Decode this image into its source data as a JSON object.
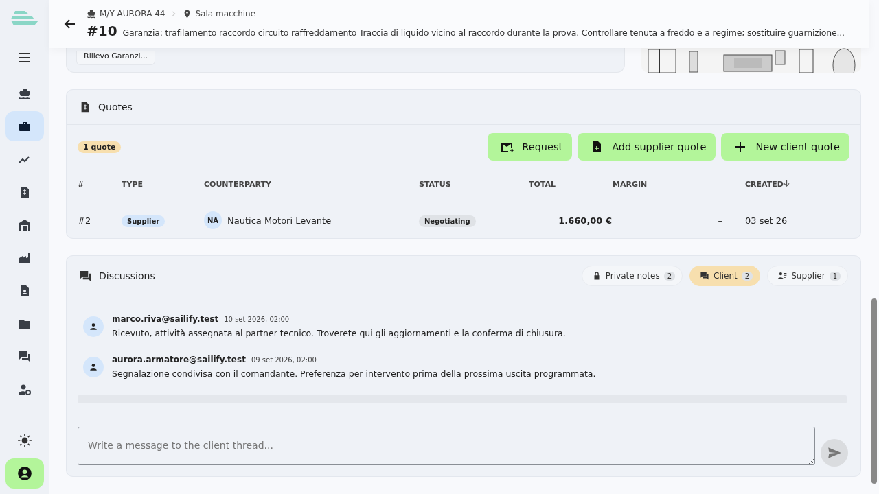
{
  "sidebar": {
    "items": [
      {
        "kind": "ship",
        "selected": false
      },
      {
        "kind": "briefcase",
        "selected": true
      },
      {
        "kind": "chart",
        "selected": false
      },
      {
        "kind": "invoice",
        "selected": false
      },
      {
        "kind": "warehouse",
        "selected": false
      },
      {
        "kind": "factory",
        "selected": false
      },
      {
        "kind": "contact",
        "selected": false
      },
      {
        "kind": "folder",
        "selected": false
      },
      {
        "kind": "chat",
        "selected": false
      },
      {
        "kind": "admin",
        "selected": false
      }
    ]
  },
  "header": {
    "vessel": "M/Y AURORA 44",
    "location": "Sala macchine",
    "number": "#10",
    "title": "Garanzia: trafilamento raccordo circuito raffreddamento Traccia di liquido vicino al raccordo durante la prova. Controllare tenuta a freddo e a regime; sostituire guarnizione..."
  },
  "top_card": {
    "chip": "Rilievo Garanzi..."
  },
  "quotes": {
    "title": "Quotes",
    "count": "1 quote",
    "buttons": [
      {
        "kind": "mail",
        "label": "Request"
      },
      {
        "kind": "file-add",
        "label": "Add supplier quote"
      },
      {
        "kind": "plus",
        "label": "New client quote"
      }
    ],
    "columns": [
      "#",
      "TYPE",
      "COUNTERPARTY",
      "STATUS",
      "TOTAL",
      "MARGIN",
      "CREATED"
    ],
    "rows": [
      {
        "number": "#2",
        "type": "Supplier",
        "initials": "NA",
        "counterparty": "Nautica Motori Levante",
        "status": "Negotiating",
        "total": "1.660,00 €",
        "margin": "–",
        "created": "03 set 26"
      }
    ]
  },
  "discussions": {
    "title": "Discussions",
    "tabs": [
      {
        "kind": "lock",
        "label": "Private notes",
        "count": "2",
        "selected": false
      },
      {
        "kind": "chat",
        "label": "Client",
        "count": "2",
        "selected": true
      },
      {
        "kind": "people",
        "label": "Supplier",
        "count": "1",
        "selected": false
      }
    ],
    "messages": [
      {
        "author": "marco.riva@sailify.test",
        "time": "10 set 2026, 02:00",
        "text": "Ricevuto, attività assegnata al partner tecnico. Troverete qui gli aggiornamenti e la conferma di chiusura."
      },
      {
        "author": "aurora.armatore@sailify.test",
        "time": "09 set 2026, 02:00",
        "text": "Segnalazione condivisa con il comandante. Preferenza per intervento prima della prossima uscita programmata."
      }
    ],
    "composer": {
      "placeholder": "Write a message to the client thread..."
    }
  }
}
